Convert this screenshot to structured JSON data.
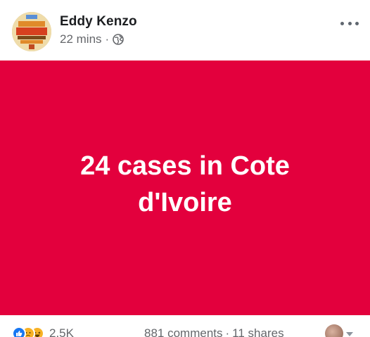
{
  "post": {
    "author": {
      "name": "Eddy Kenzo",
      "avatar_icon": "festival-logo-avatar"
    },
    "meta": {
      "time": "22 mins",
      "separator": "·",
      "privacy_icon": "globe-icon"
    },
    "more_icon": "more-options-icon",
    "card": {
      "background_color": "#e3003d",
      "text_color": "#ffffff",
      "text": "24 cases in Cote d'Ivoire"
    },
    "footer": {
      "reactions": [
        "like",
        "sad",
        "haha"
      ],
      "reaction_count": "2.5K",
      "comments": "881 comments",
      "dot": "·",
      "shares": "11 shares"
    }
  }
}
